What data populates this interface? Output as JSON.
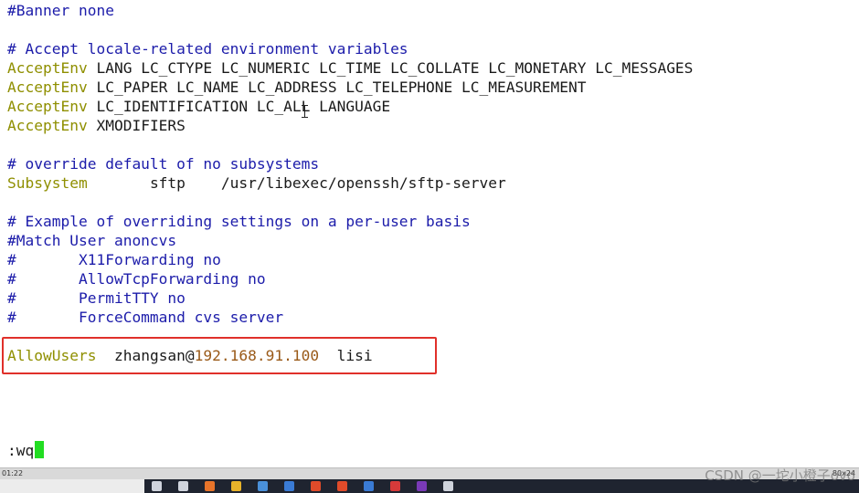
{
  "editor": {
    "lines": [
      [
        {
          "t": "#Banner none",
          "c": "c"
        }
      ],
      [],
      [
        {
          "t": "# Accept locale-related environment variables",
          "c": "c"
        }
      ],
      [
        {
          "t": "AcceptEnv",
          "c": "k"
        },
        {
          "t": " LANG LC_CTYPE LC_NUMERIC LC_TIME LC_COLLATE LC_MONETARY LC_MESSAGES",
          "c": "t"
        }
      ],
      [
        {
          "t": "AcceptEnv",
          "c": "k"
        },
        {
          "t": " LC_PAPER LC_NAME LC_ADDRESS LC_TELEPHONE LC_MEASUREMENT",
          "c": "t"
        }
      ],
      [
        {
          "t": "AcceptEnv",
          "c": "k"
        },
        {
          "t": " LC_IDENTIFICATION LC_ALL LANGUAGE",
          "c": "t"
        }
      ],
      [
        {
          "t": "AcceptEnv",
          "c": "k"
        },
        {
          "t": " XMODIFIERS",
          "c": "t"
        }
      ],
      [],
      [
        {
          "t": "# override default of no subsystems",
          "c": "c"
        }
      ],
      [
        {
          "t": "Subsystem",
          "c": "k"
        },
        {
          "t": "       sftp    /usr/libexec/openssh/sftp-server",
          "c": "t"
        }
      ],
      [],
      [
        {
          "t": "# Example of overriding settings on a per-user basis",
          "c": "c"
        }
      ],
      [
        {
          "t": "#Match User anoncvs",
          "c": "c"
        }
      ],
      [
        {
          "t": "#       X11Forwarding no",
          "c": "c"
        }
      ],
      [
        {
          "t": "#       AllowTcpForwarding no",
          "c": "c"
        }
      ],
      [
        {
          "t": "#       PermitTTY no",
          "c": "c"
        }
      ],
      [
        {
          "t": "#       ForceCommand cvs server",
          "c": "c"
        }
      ],
      [],
      [
        {
          "t": "AllowUsers",
          "c": "k"
        },
        {
          "t": "  zhangsan@",
          "c": "t"
        },
        {
          "t": "192.168.91.100",
          "c": "n"
        },
        {
          "t": "  lisi",
          "c": "t"
        }
      ]
    ],
    "command": ":wq"
  },
  "status_bar": {
    "time": "01:22",
    "size": "80x24"
  },
  "watermark": "CSDN @一坨小橙子ovo",
  "colors": {
    "comment": "#1c1caa",
    "keyword": "#8f8f00",
    "number": "#9a5a18",
    "highlight_box": "#e0302a",
    "cursor": "#22dd22"
  },
  "taskbar": {
    "icons": [
      "search-icon",
      "task-view-icon",
      "app-icon-orange",
      "folder-icon",
      "files-icon",
      "window-icon",
      "record-icon",
      "chrome-icon",
      "store-icon",
      "wps-icon",
      "onenote-icon",
      "typora-icon"
    ]
  }
}
